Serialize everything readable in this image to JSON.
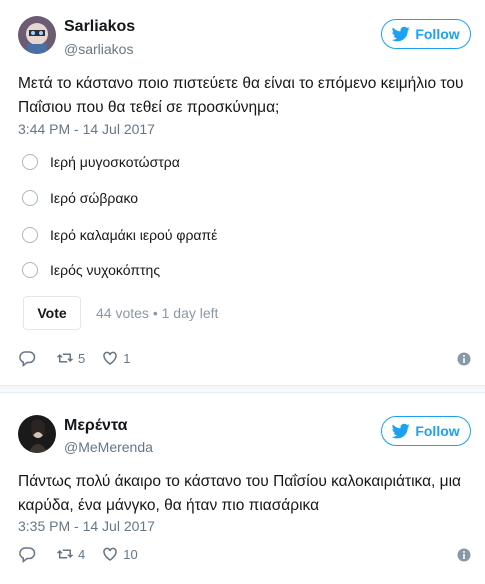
{
  "tweets": [
    {
      "author_name": "Sarliakos",
      "handle": "@sarliakos",
      "follow_label": "Follow",
      "text": "Μετά το κάστανο ποιο πιστεύετε θα είναι το επόμενο κειμήλιο του Παΐσιου που θα τεθεί σε προσκύνημα;",
      "timestamp": "3:44 PM - 14 Jul 2017",
      "poll": {
        "options": [
          "Ιερή μυγοσκοτώστρα",
          "Ιερό σώβρακο",
          "Ιερό καλαμάκι ιερού φραπέ",
          "Ιερός νυχοκόπτης"
        ],
        "vote_label": "Vote",
        "meta": "44 votes • 1 day left"
      },
      "retweets": "5",
      "likes": "1"
    },
    {
      "author_name": "Μερέντα",
      "handle": "@MeMerenda",
      "follow_label": "Follow",
      "text": "Πάντως πολύ άκαιρο το κάστανο του Παΐσίου καλοκαιριάτικα, μια καρύδα, ένα μάνγκο, θα ήταν πιο πιασάρικα",
      "timestamp": "3:35 PM - 14 Jul 2017",
      "retweets": "4",
      "likes": "10"
    }
  ],
  "colors": {
    "accent": "#1da1f2",
    "muted": "#657786",
    "text": "#14171a"
  }
}
